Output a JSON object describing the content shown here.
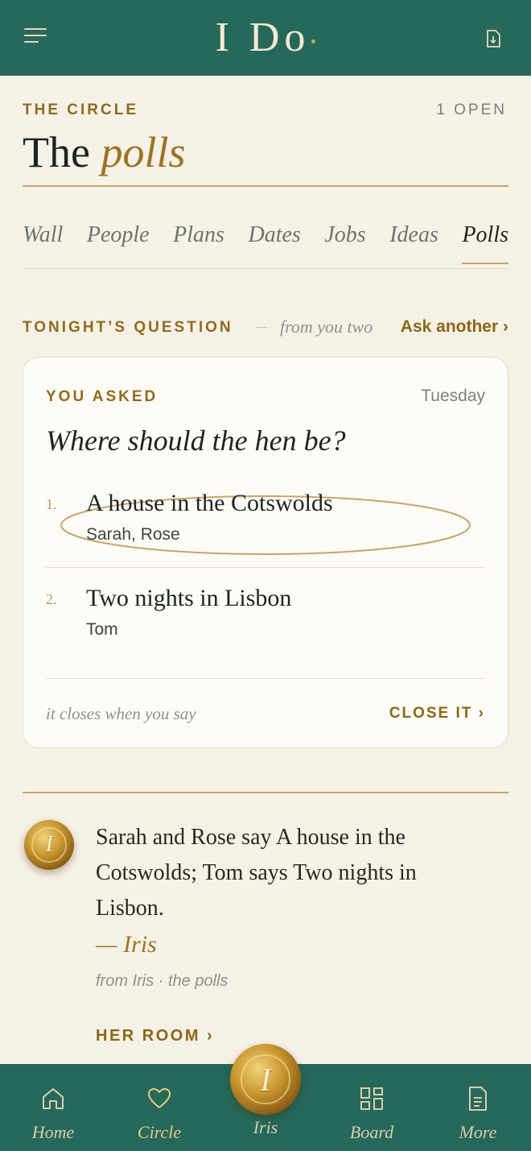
{
  "app": {
    "logo": "I Do"
  },
  "header": {
    "eyebrow": "THE CIRCLE",
    "open_count": "1 OPEN",
    "title_plain": "The",
    "title_accent": "polls"
  },
  "tabs": [
    {
      "label": "Wall",
      "active": false
    },
    {
      "label": "People",
      "active": false
    },
    {
      "label": "Plans",
      "active": false
    },
    {
      "label": "Dates",
      "active": false
    },
    {
      "label": "Jobs",
      "active": false
    },
    {
      "label": "Ideas",
      "active": false
    },
    {
      "label": "Polls",
      "active": true
    }
  ],
  "tonight": {
    "label": "TONIGHT’S QUESTION",
    "from": "from you two",
    "ask_another": "Ask another ›"
  },
  "poll": {
    "eyebrow": "YOU ASKED",
    "day": "Tuesday",
    "question": "Where should the hen be?",
    "options": [
      {
        "number": "1.",
        "label": "A house in the Cotswolds",
        "voters": "Sarah, Rose",
        "circled": true
      },
      {
        "number": "2.",
        "label": "Two nights in Lisbon",
        "voters": "Tom",
        "circled": false
      }
    ],
    "footnote": "it closes when you say",
    "close_label": "CLOSE IT ›"
  },
  "iris_note": {
    "seal_letter": "I",
    "text": "Sarah and Rose say A house in the Cotswolds; Tom says Two nights in Lisbon.",
    "signature": "— Iris",
    "source": "from Iris · the polls",
    "link": "HER ROOM ›"
  },
  "bottom_nav": {
    "items": [
      {
        "label": "Home",
        "icon": "home-icon"
      },
      {
        "label": "Circle",
        "icon": "heart-icon",
        "active": true
      },
      {
        "label": "Iris",
        "icon": "wax-seal-icon"
      },
      {
        "label": "Board",
        "icon": "grid-icon"
      },
      {
        "label": "More",
        "icon": "document-icon"
      }
    ]
  },
  "colors": {
    "brand_green": "#26695a",
    "gold": "#8f6b1e",
    "background": "#f6f1e7"
  }
}
